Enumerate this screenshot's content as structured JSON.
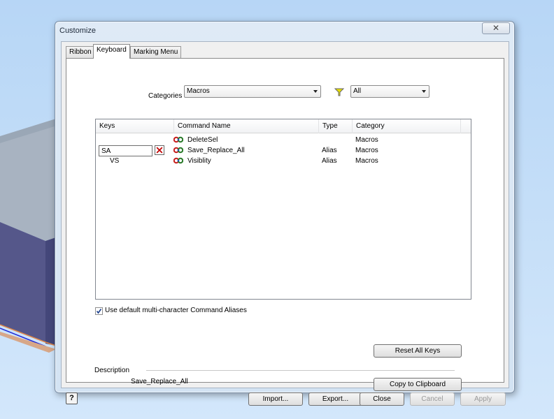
{
  "window": {
    "title": "Customize",
    "close_glyph": "✕"
  },
  "tabs": [
    {
      "label": "Ribbon",
      "active": false
    },
    {
      "label": "Keyboard",
      "active": true
    },
    {
      "label": "Marking Menu",
      "active": false
    }
  ],
  "categories": {
    "label": "Categories",
    "selected": "Macros"
  },
  "filter": {
    "icon": "filter-icon",
    "color": "#e8e000",
    "selected": "All"
  },
  "table": {
    "columns": [
      "Keys",
      "Command Name",
      "Type",
      "Category"
    ],
    "rows": [
      {
        "keys": "",
        "command": "DeleteSel",
        "type": "",
        "category": "Macros",
        "editing": false
      },
      {
        "keys": "SA",
        "command": "Save_Replace_All",
        "type": "Alias",
        "category": "Macros",
        "editing": true
      },
      {
        "keys": "VS",
        "command": "Visiblity",
        "type": "Alias",
        "category": "Macros",
        "editing": false
      }
    ]
  },
  "aliases_checkbox": {
    "label": "Use default multi-character Command Aliases",
    "checked": true
  },
  "reset_button": "Reset All Keys",
  "description": {
    "label": "Description",
    "text": "Save_Replace_All"
  },
  "copy_button": "Copy to Clipboard",
  "footer": {
    "help": "?",
    "import": "Import...",
    "export": "Export...",
    "close": "Close",
    "cancel": "Cancel",
    "apply": "Apply"
  },
  "colors": {
    "accent": "#3c6fb4",
    "delete_x": "#c00000"
  }
}
